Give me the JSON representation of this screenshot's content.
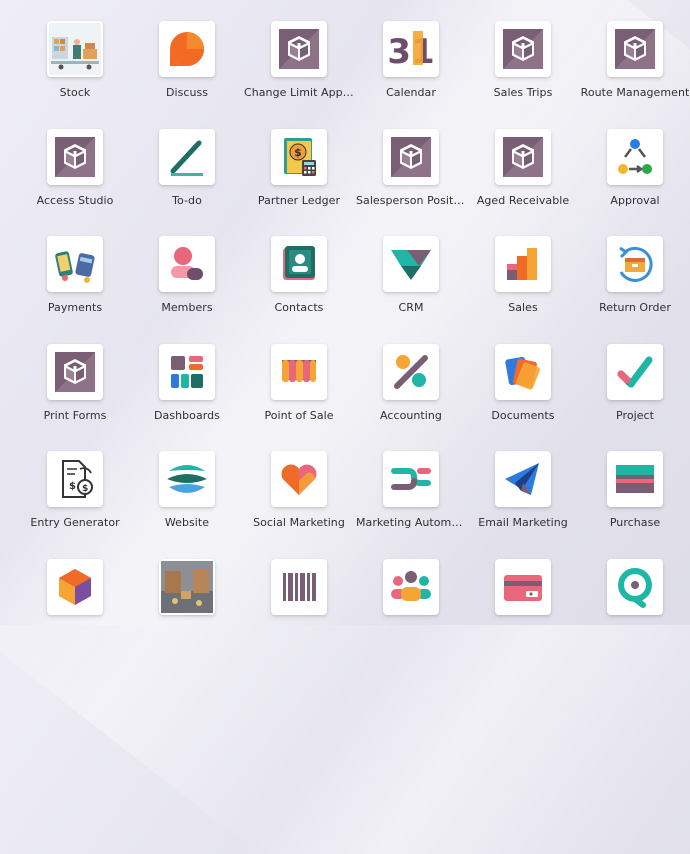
{
  "apps": [
    {
      "label": "Stock",
      "icon": "stock-icon"
    },
    {
      "label": "Discuss",
      "icon": "discuss-icon"
    },
    {
      "label": "Change Limit Appr...",
      "icon": "box-icon"
    },
    {
      "label": "Calendar",
      "icon": "calendar-icon",
      "calendar_day": "31"
    },
    {
      "label": "Sales Trips",
      "icon": "box-icon"
    },
    {
      "label": "Route Management",
      "icon": "box-icon"
    },
    {
      "label": "Access Studio",
      "icon": "box-icon"
    },
    {
      "label": "To-do",
      "icon": "todo-icon"
    },
    {
      "label": "Partner Ledger",
      "icon": "ledger-icon"
    },
    {
      "label": "Salesperson Positi...",
      "icon": "box-icon"
    },
    {
      "label": "Aged Receivable",
      "icon": "box-icon"
    },
    {
      "label": "Approval",
      "icon": "approval-icon"
    },
    {
      "label": "Payments",
      "icon": "payments-icon"
    },
    {
      "label": "Members",
      "icon": "members-icon"
    },
    {
      "label": "Contacts",
      "icon": "contacts-icon"
    },
    {
      "label": "CRM",
      "icon": "crm-icon"
    },
    {
      "label": "Sales",
      "icon": "sales-icon"
    },
    {
      "label": "Return Order",
      "icon": "return-order-icon"
    },
    {
      "label": "Print Forms",
      "icon": "box-icon"
    },
    {
      "label": "Dashboards",
      "icon": "dashboards-icon"
    },
    {
      "label": "Point of Sale",
      "icon": "point-of-sale-icon"
    },
    {
      "label": "Accounting",
      "icon": "accounting-icon"
    },
    {
      "label": "Documents",
      "icon": "documents-icon"
    },
    {
      "label": "Project",
      "icon": "project-icon"
    },
    {
      "label": "Entry Generator",
      "icon": "entry-generator-icon"
    },
    {
      "label": "Website",
      "icon": "website-icon"
    },
    {
      "label": "Social Marketing",
      "icon": "social-marketing-icon"
    },
    {
      "label": "Marketing Automa...",
      "icon": "marketing-automation-icon"
    },
    {
      "label": "Email Marketing",
      "icon": "email-marketing-icon"
    },
    {
      "label": "Purchase",
      "icon": "purchase-icon"
    },
    {
      "label": "",
      "icon": "inventory-cube-icon"
    },
    {
      "label": "",
      "icon": "warehouse-photo-icon"
    },
    {
      "label": "",
      "icon": "barcode-icon"
    },
    {
      "label": "",
      "icon": "employees-icon"
    },
    {
      "label": "",
      "icon": "card-icon"
    },
    {
      "label": "",
      "icon": "location-icon"
    }
  ],
  "colors": {
    "box_purple": "#7a5f74",
    "box_purple_light": "#9a7d92",
    "orange": "#f06a28",
    "teal": "#1fb6a6",
    "pink": "#e8677a",
    "dark_teal": "#1e6e66"
  }
}
